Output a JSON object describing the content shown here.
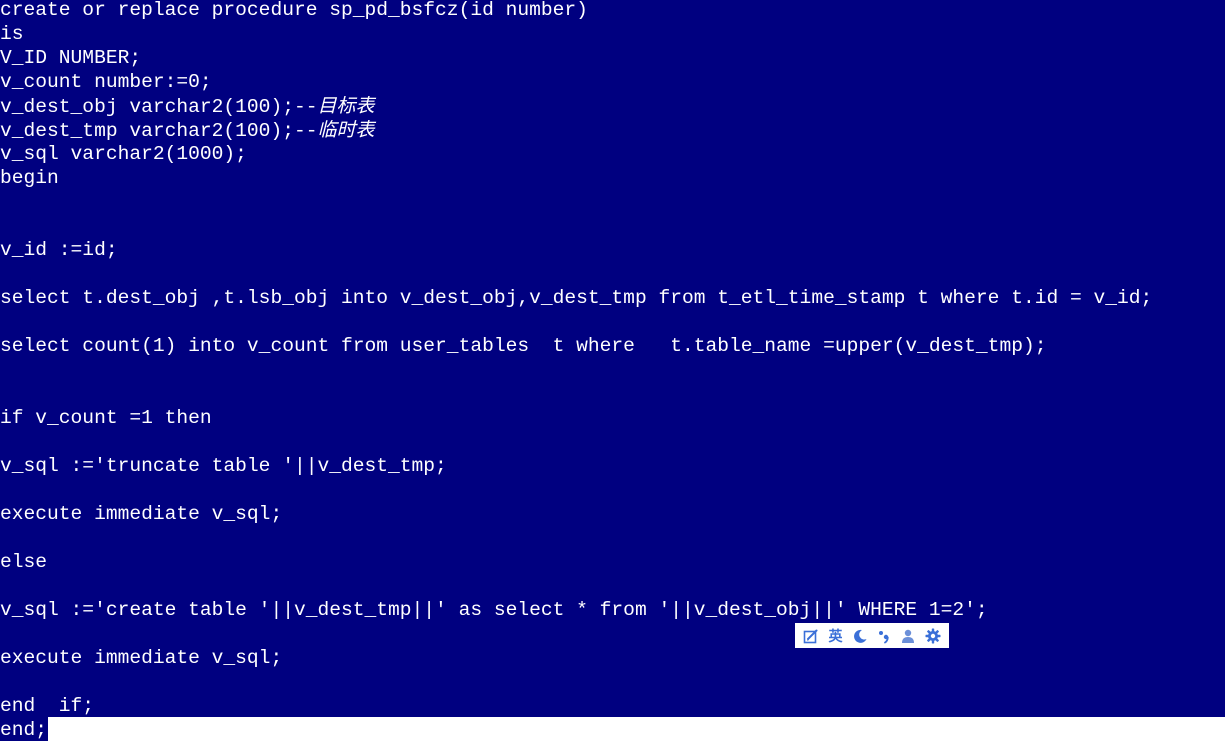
{
  "editor": {
    "lines": [
      "create or replace procedure sp_pd_bsfcz(id number)",
      "is",
      "V_ID NUMBER;",
      "v_count number:=0;",
      "v_dest_obj varchar2(100);--",
      "v_dest_tmp varchar2(100);--",
      "v_sql varchar2(1000);",
      "begin",
      "v_id :=id;",
      "select t.dest_obj ,t.lsb_obj into v_dest_obj,v_dest_tmp from t_etl_time_stamp t where t.id = v_id;",
      "select count(1) into v_count from user_tables  t where   t.table_name =upper(v_dest_tmp);",
      "if v_count =1 then",
      "v_sql :='truncate table '||v_dest_tmp;",
      "execute immediate v_sql;",
      "else",
      "v_sql :='create table '||v_dest_tmp||' as select * from '||v_dest_obj||' WHERE 1=2';",
      "execute immediate v_sql;",
      "end  if;",
      "end;"
    ],
    "comments": {
      "dest_obj": "目标表",
      "dest_tmp": "临时表"
    }
  },
  "ime_toolbar": {
    "buttons": [
      {
        "name": "skin-icon",
        "glyph": ""
      },
      {
        "name": "lang-toggle",
        "glyph": "英"
      },
      {
        "name": "moon-icon",
        "glyph": ""
      },
      {
        "name": "punctuation-icon",
        "glyph": "•,"
      },
      {
        "name": "user-icon",
        "glyph": ""
      },
      {
        "name": "gear-icon",
        "glyph": ""
      }
    ],
    "accent": "#3a6fd8"
  },
  "colors": {
    "editor_bg": "#000080",
    "text": "#ffffff"
  }
}
